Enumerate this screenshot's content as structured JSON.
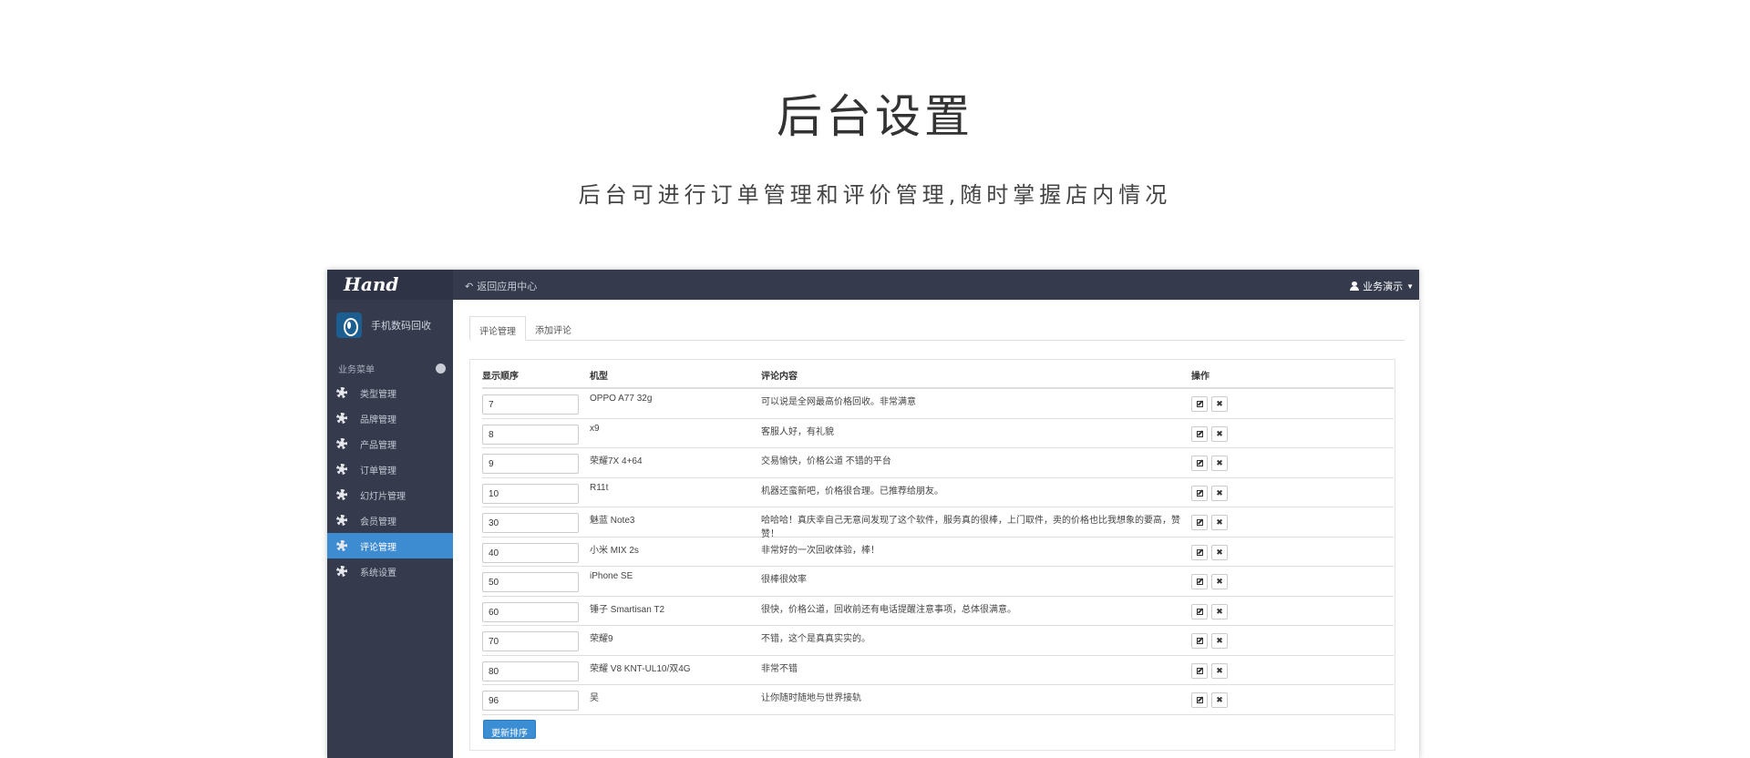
{
  "hero": {
    "title": "后台设置",
    "subtitle": "后台可进行订单管理和评价管理,随时掌握店内情况"
  },
  "topbar": {
    "brand": "Hand",
    "back_link": "返回应用中心",
    "user": "业务演示"
  },
  "sidebar": {
    "app_name": "手机数码回收",
    "menu_header": "业务菜单",
    "items": [
      {
        "label": "类型管理"
      },
      {
        "label": "品牌管理"
      },
      {
        "label": "产品管理"
      },
      {
        "label": "订单管理"
      },
      {
        "label": "幻灯片管理"
      },
      {
        "label": "会员管理"
      },
      {
        "label": "评论管理"
      },
      {
        "label": "系统设置"
      }
    ]
  },
  "tabs": [
    {
      "label": "评论管理"
    },
    {
      "label": "添加评论"
    }
  ],
  "table": {
    "headers": [
      "显示顺序",
      "机型",
      "评论内容",
      "操作"
    ],
    "rows": [
      {
        "order": "7",
        "model": "OPPO A77 32g",
        "comment": "可以说是全网最高价格回收。非常满意"
      },
      {
        "order": "8",
        "model": "x9",
        "comment": "客服人好，有礼貌"
      },
      {
        "order": "9",
        "model": "荣耀7X 4+64",
        "comment": "交易愉快，价格公道 不错的平台"
      },
      {
        "order": "10",
        "model": "R11t",
        "comment": "机器还蛮新吧，价格很合理。已推荐给朋友。"
      },
      {
        "order": "30",
        "model": "魅蓝 Note3",
        "comment": "哈哈哈！真庆幸自己无意间发现了这个软件，服务真的很棒，上门取件，卖的价格也比我想象的要高，赞赞！"
      },
      {
        "order": "40",
        "model": "小米 MIX 2s",
        "comment": "非常好的一次回收体验，棒！"
      },
      {
        "order": "50",
        "model": "iPhone SE",
        "comment": "很棒很效率"
      },
      {
        "order": "60",
        "model": "锤子 Smartisan T2",
        "comment": "很快，价格公道，回收前还有电话提醒注意事项，总体很满意。"
      },
      {
        "order": "70",
        "model": "荣耀9",
        "comment": "不错，这个是真真实实的。"
      },
      {
        "order": "80",
        "model": "荣耀 V8 KNT-UL10/双4G",
        "comment": "非常不错"
      },
      {
        "order": "96",
        "model": "吴",
        "comment": "让你随时随地与世界接轨"
      }
    ]
  },
  "update_button": "更新排序",
  "colors": {
    "topbar": "#353b4d",
    "sidebar": "#353b4d",
    "active_item": "#3d8bd0",
    "primary_button": "#3c8ed4"
  }
}
